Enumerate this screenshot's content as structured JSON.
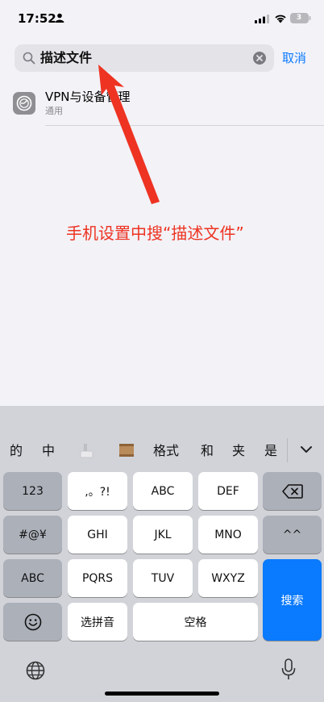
{
  "status": {
    "time": "17:52",
    "battery": "3"
  },
  "search": {
    "query": "描述文件",
    "cancel_label": "取消"
  },
  "result": {
    "title": "VPN与设备管理",
    "subtitle": "通用"
  },
  "annotation": {
    "text": "手机设置中搜“描述文件”"
  },
  "keyboard": {
    "candidates": [
      "的",
      "中",
      "格式",
      "和",
      "夹",
      "是"
    ],
    "keys": {
      "k123": "123",
      "punct": ",。?!",
      "abc_key": "ABC",
      "def": "DEF",
      "symbols": "#@¥",
      "ghi": "GHI",
      "jkl": "JKL",
      "mno": "MNO",
      "caret": "^^",
      "abc_mode": "ABC",
      "pqrs": "PQRS",
      "tuv": "TUV",
      "wxyz": "WXYZ",
      "search": "搜索",
      "pinyin": "选拼音",
      "space": "空格"
    }
  },
  "colors": {
    "accent": "#0a7aff",
    "annotation": "#ee3322",
    "keyboard_bg": "#d1d3d9"
  },
  "icons": [
    "person-icon",
    "signal-icon",
    "wifi-icon",
    "battery-icon",
    "search-icon",
    "clear-icon",
    "gear-icon",
    "chevron-down-icon",
    "backspace-icon",
    "emoji-icon",
    "globe-icon",
    "mic-icon"
  ]
}
